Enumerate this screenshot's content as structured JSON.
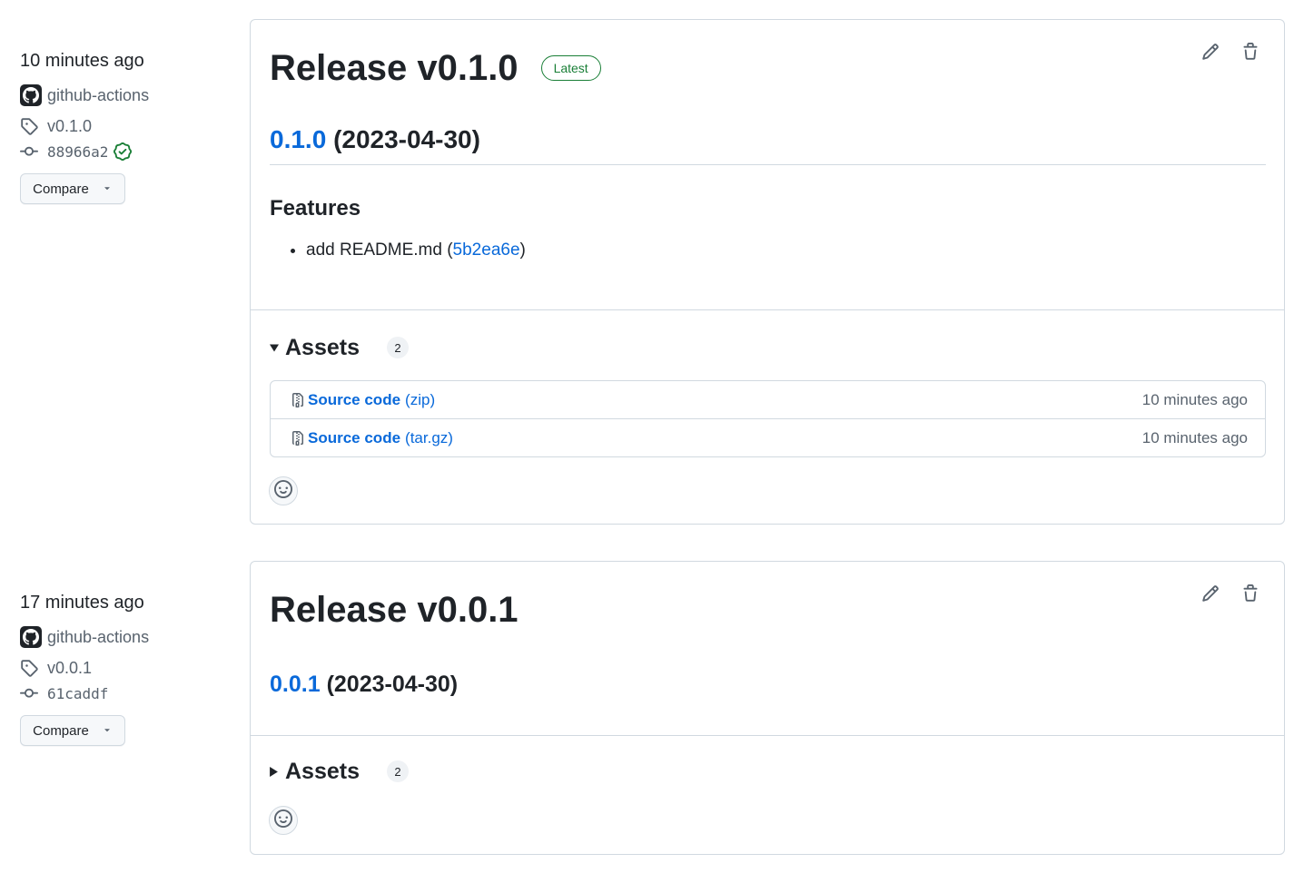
{
  "releases": [
    {
      "time": "10 minutes ago",
      "author": "github-actions",
      "tag": "v0.1.0",
      "commit": "88966a2",
      "commit_verified": true,
      "compare_label": "Compare",
      "title": "Release v0.1.0",
      "latest_badge": "Latest",
      "version_link": "0.1.0",
      "version_date": "(2023-04-30)",
      "features_heading": "Features",
      "features": [
        {
          "text": "add README.md (",
          "commit": "5b2ea6e",
          "suffix": ")"
        }
      ],
      "assets_label": "Assets",
      "assets_count": "2",
      "assets_expanded": true,
      "assets": [
        {
          "name": "Source code",
          "ext": "(zip)",
          "time": "10 minutes ago"
        },
        {
          "name": "Source code",
          "ext": "(tar.gz)",
          "time": "10 minutes ago"
        }
      ]
    },
    {
      "time": "17 minutes ago",
      "author": "github-actions",
      "tag": "v0.0.1",
      "commit": "61caddf",
      "commit_verified": false,
      "compare_label": "Compare",
      "title": "Release v0.0.1",
      "version_link": "0.0.1",
      "version_date": "(2023-04-30)",
      "assets_label": "Assets",
      "assets_count": "2",
      "assets_expanded": false
    }
  ],
  "icons": {
    "avatar": "github-mark-icon",
    "tag": "tag-icon",
    "commit": "git-commit-icon",
    "verified": "verified-check-icon",
    "dropdown": "triangle-down-icon",
    "edit": "pencil-icon",
    "delete": "trash-icon",
    "zip": "file-zip-icon",
    "reaction": "smiley-icon"
  },
  "colors": {
    "link": "#0969da",
    "verified": "#1a7f37",
    "muted": "#59636e",
    "border": "#d1d9e0"
  }
}
